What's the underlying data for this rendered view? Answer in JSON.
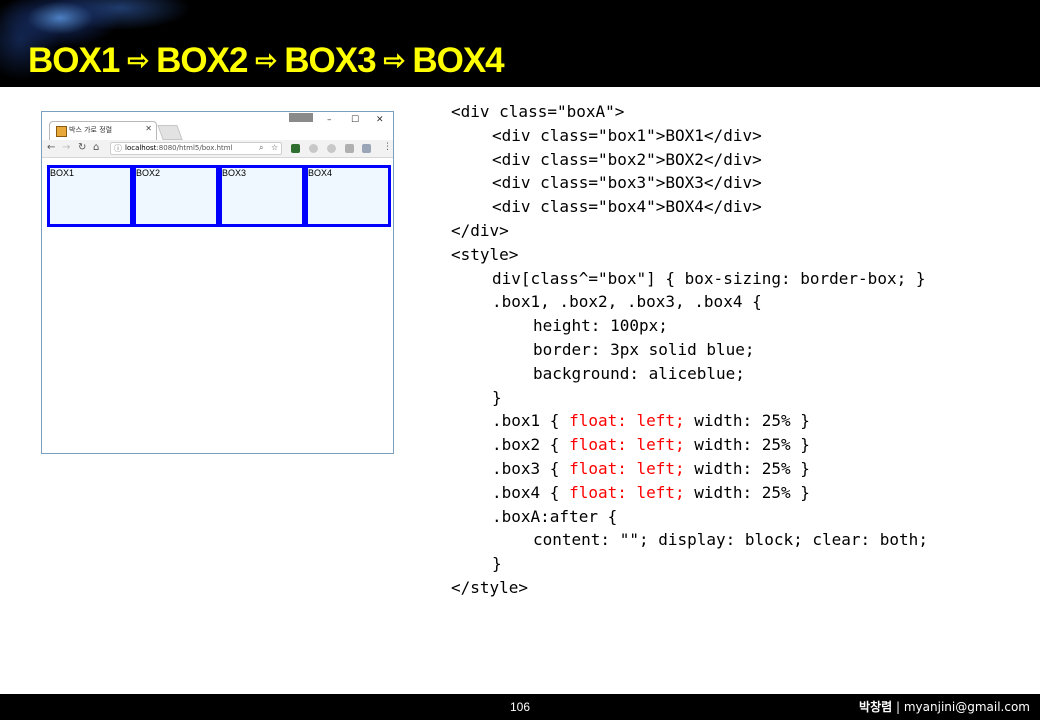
{
  "header": {
    "title_items": [
      "BOX1",
      "BOX2",
      "BOX3",
      "BOX4"
    ],
    "arrow": "⇨"
  },
  "browser": {
    "tab_title": "박스 가로 정렬",
    "url_host": "localhost",
    "url_rest": ":8080/html5/box.html",
    "boxes": [
      "BOX1",
      "BOX2",
      "BOX3",
      "BOX4"
    ]
  },
  "code_lines": [
    {
      "indent": 0,
      "parts": [
        {
          "t": "<div class=\"boxA\">"
        }
      ]
    },
    {
      "indent": 1,
      "parts": [
        {
          "t": "<div class=\"box1\">BOX1</div>"
        }
      ]
    },
    {
      "indent": 1,
      "parts": [
        {
          "t": "<div class=\"box2\">BOX2</div>"
        }
      ]
    },
    {
      "indent": 1,
      "parts": [
        {
          "t": "<div class=\"box3\">BOX3</div>"
        }
      ]
    },
    {
      "indent": 1,
      "parts": [
        {
          "t": "<div class=\"box4\">BOX4</div>"
        }
      ]
    },
    {
      "indent": 0,
      "parts": [
        {
          "t": "</div>"
        }
      ]
    },
    {
      "indent": 0,
      "parts": [
        {
          "t": "<style>"
        }
      ]
    },
    {
      "indent": 1,
      "parts": [
        {
          "t": "div[class^=\"box\"] { box-sizing: border-box; }"
        }
      ]
    },
    {
      "indent": 1,
      "parts": [
        {
          "t": ".box1, .box2, .box3, .box4 {"
        }
      ]
    },
    {
      "indent": 2,
      "parts": [
        {
          "t": "height: 100px;"
        }
      ]
    },
    {
      "indent": 2,
      "parts": [
        {
          "t": "border: 3px solid blue;"
        }
      ]
    },
    {
      "indent": 2,
      "parts": [
        {
          "t": "background: aliceblue;"
        }
      ]
    },
    {
      "indent": 1,
      "parts": [
        {
          "t": "}"
        }
      ]
    },
    {
      "indent": 1,
      "parts": [
        {
          "t": ".box1 { "
        },
        {
          "t": "float: left;",
          "hl": true
        },
        {
          "t": " width: 25% }"
        }
      ]
    },
    {
      "indent": 1,
      "parts": [
        {
          "t": ".box2 { "
        },
        {
          "t": "float: left;",
          "hl": true
        },
        {
          "t": " width: 25% }"
        }
      ]
    },
    {
      "indent": 1,
      "parts": [
        {
          "t": ".box3 { "
        },
        {
          "t": "float: left;",
          "hl": true
        },
        {
          "t": " width: 25% }"
        }
      ]
    },
    {
      "indent": 1,
      "parts": [
        {
          "t": ".box4 { "
        },
        {
          "t": "float: left;",
          "hl": true
        },
        {
          "t": " width: 25% }"
        }
      ]
    },
    {
      "indent": 1,
      "parts": [
        {
          "t": ".boxA:after {"
        }
      ]
    },
    {
      "indent": 2,
      "parts": [
        {
          "t": "content: \"\"; display: block; clear: both;"
        }
      ]
    },
    {
      "indent": 1,
      "parts": [
        {
          "t": "}"
        }
      ]
    },
    {
      "indent": 0,
      "parts": [
        {
          "t": "</style>"
        }
      ]
    }
  ],
  "footer": {
    "page_number": "106",
    "author": "박창렴",
    "separator": "|",
    "email": "myanjini@gmail.com"
  },
  "colors": {
    "title": "#ffff00",
    "highlight": "#ff0000",
    "box_border": "#0000ff",
    "box_bg": "#f0f8ff"
  }
}
